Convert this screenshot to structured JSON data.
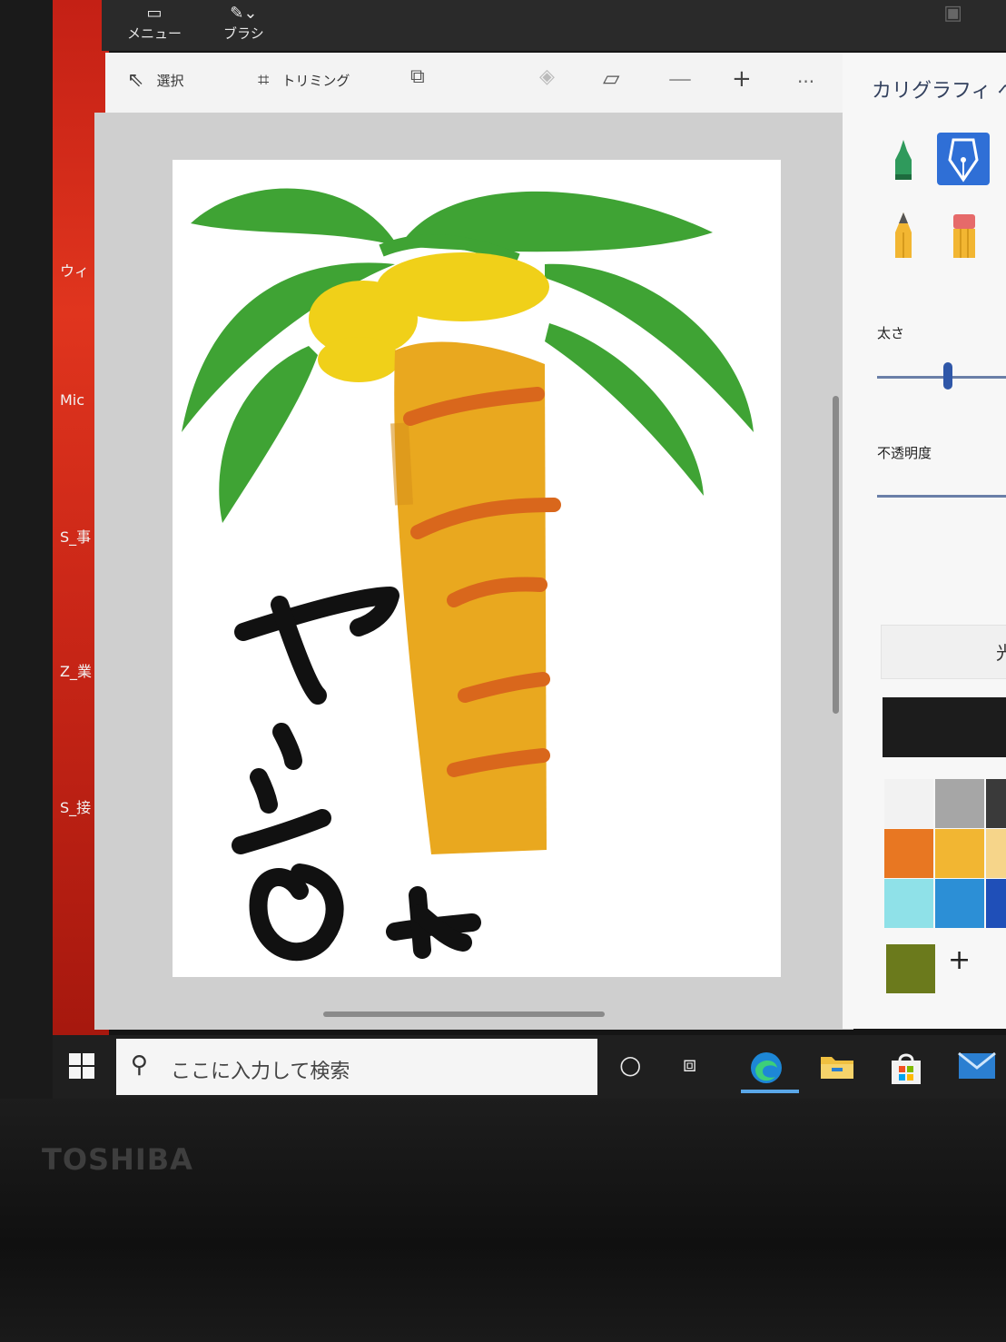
{
  "appbar": {
    "menu_label": "メニュー",
    "brush_label": "ブラシ"
  },
  "toolbar": {
    "select_label": "選択",
    "crop_label": "トリミング",
    "zoom_out_symbol": "—",
    "zoom_in_symbol": "+",
    "more_symbol": "···"
  },
  "desktop_icons": [
    "ウィ",
    "Mic",
    "S_事",
    "Z_業",
    "S_接"
  ],
  "panel": {
    "title": "カリグラフィ ペン",
    "thickness_label": "太さ",
    "opacity_label": "不透明度",
    "partial_button_label": "光",
    "thickness_level": 0.55,
    "opacity_level": 1.0,
    "tools": [
      "marker-icon",
      "calligraphy-pen-icon",
      "pencil-icon",
      "eraser-icon"
    ],
    "selected_tool": "calligraphy-pen-icon",
    "current_color": "#1c1c1c",
    "palette": [
      "#f2f2f2",
      "#a6a6a6",
      "#3a3a3a",
      "#e87722",
      "#f2b632",
      "#f6d58a",
      "#8fe1e8",
      "#2c8fd6",
      "#1f4fb8"
    ],
    "custom_color": "#6b7a1c",
    "add_color_symbol": "+"
  },
  "drawing": {
    "text_lines": [
      "ヤシ",
      "の木"
    ],
    "colors": {
      "leaves": "#3fa334",
      "coconuts": "#f0d019",
      "trunk": "#e9a81f",
      "rings": "#d9671c",
      "ink": "#111111"
    }
  },
  "taskbar": {
    "search_placeholder": "ここに入力して検索",
    "apps": [
      "cortana-icon",
      "task-view-icon",
      "edge-icon",
      "file-explorer-icon",
      "store-icon",
      "mail-icon"
    ]
  },
  "laptop": {
    "brand": "TOSHIBA"
  }
}
